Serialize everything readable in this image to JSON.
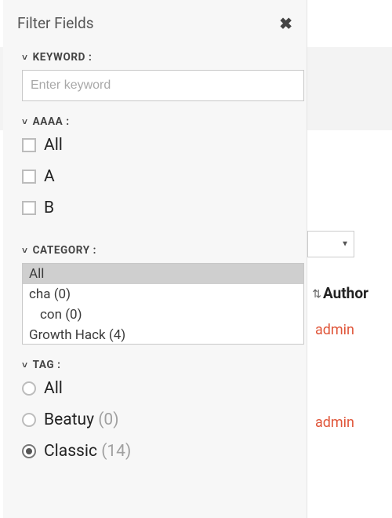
{
  "panel": {
    "title": "Filter Fields",
    "close_glyph": "✖",
    "chevron_glyph": "˅"
  },
  "keyword": {
    "heading": "KEYWORD :",
    "placeholder": "Enter keyword",
    "value": ""
  },
  "aaaa": {
    "heading": "AAAA :",
    "options": [
      {
        "label": "All"
      },
      {
        "label": "A"
      },
      {
        "label": "B"
      }
    ]
  },
  "category": {
    "heading": "CATEGORY :",
    "items": [
      {
        "label": "All",
        "selected": true,
        "indent": 0
      },
      {
        "label": "cha (0)",
        "selected": false,
        "indent": 0
      },
      {
        "label": "con (0)",
        "selected": false,
        "indent": 1
      },
      {
        "label": "Growth Hack (4)",
        "selected": false,
        "indent": 0
      }
    ]
  },
  "tag": {
    "heading": "TAG :",
    "options": [
      {
        "label": "All",
        "count": "",
        "selected": false
      },
      {
        "label": "Beatuy ",
        "count": "(0)",
        "selected": false
      },
      {
        "label": "Classic ",
        "count": "(14)",
        "selected": true
      }
    ]
  },
  "background": {
    "author_header": "Author",
    "admin_link_1": "admin",
    "admin_link_2": "admin",
    "sort_glyph": "⇅"
  }
}
